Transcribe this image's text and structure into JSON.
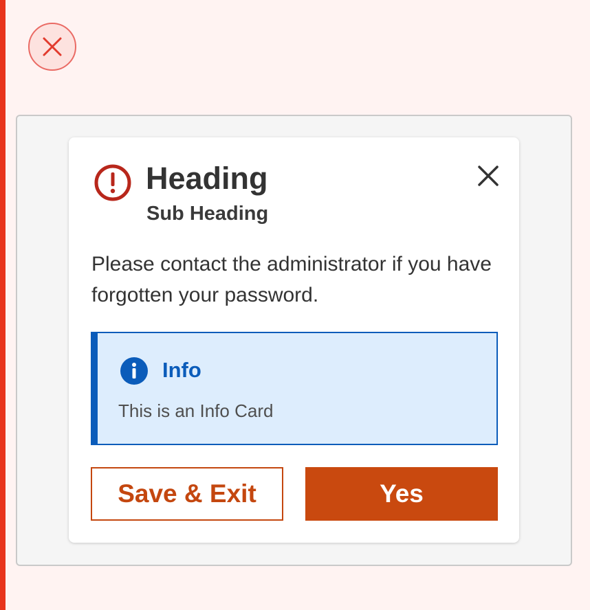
{
  "dialog": {
    "heading": "Heading",
    "subheading": "Sub Heading",
    "message": "Please contact the administrator if you have forgotten your password.",
    "status_icon": "alert-circle-icon",
    "close_icon": "close-icon"
  },
  "info_card": {
    "title": "Info",
    "text": "This is an Info Card",
    "icon": "info-icon"
  },
  "buttons": {
    "secondary_label": "Save & Exit",
    "primary_label": "Yes"
  },
  "outer": {
    "dismiss_icon": "close-circle-icon"
  },
  "colors": {
    "accent": "#c9490f",
    "error": "#b8271b",
    "info": "#0b5cba",
    "info_bg": "#ddedfd",
    "page_bg": "#fff3f2",
    "side_bar": "#e8341c"
  }
}
